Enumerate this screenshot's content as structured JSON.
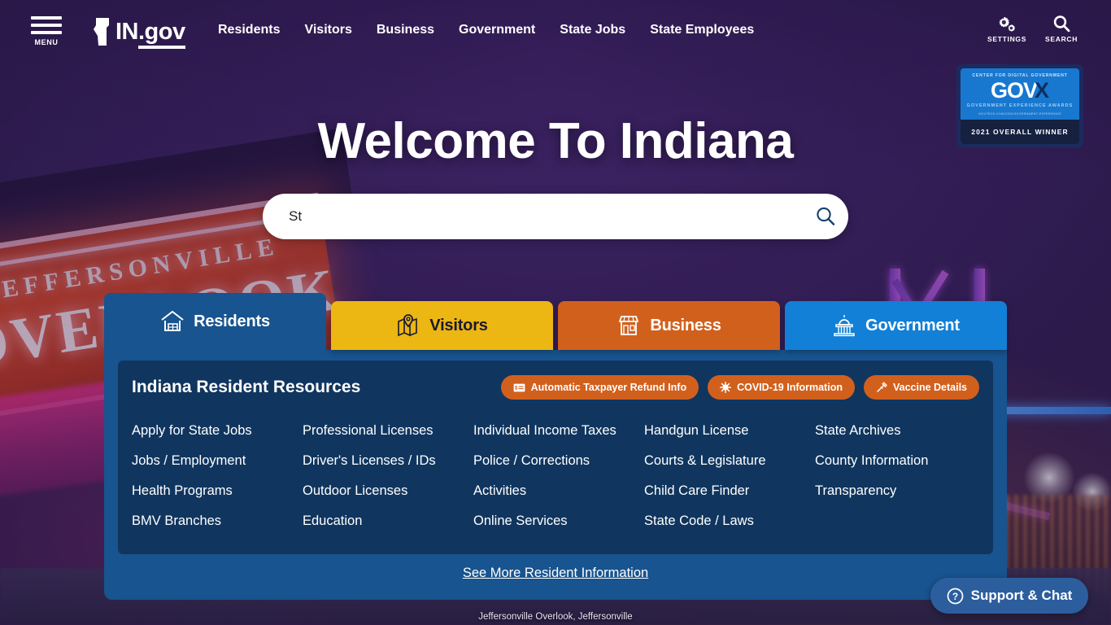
{
  "header": {
    "menu_label": "MENU",
    "logo_text_1": "IN",
    "logo_text_2": ".gov",
    "nav": [
      {
        "label": "Residents"
      },
      {
        "label": "Visitors"
      },
      {
        "label": "Business"
      },
      {
        "label": "Government"
      },
      {
        "label": "State Jobs"
      },
      {
        "label": "State Employees"
      }
    ],
    "utilities": [
      {
        "label": "SETTINGS",
        "icon": "gears-icon"
      },
      {
        "label": "SEARCH",
        "icon": "search-icon"
      }
    ]
  },
  "award_badge": {
    "top_text": "CENTER FOR DIGITAL GOVERNMENT",
    "brand": "GOV",
    "brand_mark": "X",
    "subtitle": "GOVERNMENT EXPERIENCE AWARDS",
    "url": "GOVTECH.COM/CDG/GOVERNMENT-EXPERIENCE",
    "winner_text": "2021 OVERALL WINNER"
  },
  "hero": {
    "title": "Welcome To Indiana",
    "search": {
      "value": "St",
      "placeholder": "",
      "button_icon": "search-icon"
    }
  },
  "tabs": [
    {
      "label": "Residents",
      "icon": "house-icon",
      "active": true,
      "bg": "#18548f",
      "fg": "#ffffff"
    },
    {
      "label": "Visitors",
      "icon": "map-pin-icon",
      "active": false,
      "bg": "#ecb613",
      "fg": "#1a1a2e"
    },
    {
      "label": "Business",
      "icon": "store-icon",
      "active": false,
      "bg": "#d2601d",
      "fg": "#ffffff"
    },
    {
      "label": "Government",
      "icon": "capitol-icon",
      "active": false,
      "bg": "#1180d6",
      "fg": "#ffffff"
    }
  ],
  "panel": {
    "title": "Indiana Resident Resources",
    "pills": [
      {
        "label": "Automatic Taxpayer Refund Info",
        "icon": "money-check-icon"
      },
      {
        "label": "COVID-19 Information",
        "icon": "virus-icon"
      },
      {
        "label": "Vaccine Details",
        "icon": "syringe-icon"
      }
    ],
    "links": [
      "Apply for State Jobs",
      "Professional Licenses",
      "Individual Income Taxes",
      "Handgun License",
      "State Archives",
      "Jobs / Employment",
      "Driver's Licenses / IDs",
      "Police / Corrections",
      "Courts & Legislature",
      "County Information",
      "Health Programs",
      "Outdoor Licenses",
      "Activities",
      "Child Care Finder",
      "Transparency",
      "BMV Branches",
      "Education",
      "Online Services",
      "State Code / Laws",
      ""
    ],
    "see_more": "See More Resident Information"
  },
  "photo_caption": "Jeffersonville Overlook, Jeffersonville",
  "chat_widget": {
    "label": "Support & Chat",
    "icon": "question-circle-icon"
  },
  "background": {
    "sign_text_top": "JEFFERSONVILLE",
    "sign_text_main": "OVERLOOK"
  },
  "colors": {
    "purple_bg": "#33205c",
    "panel_blue": "#18548f",
    "panel_inner": "#10365f",
    "orange": "#d2601d",
    "gold": "#ecb613",
    "light_blue": "#1180d6"
  }
}
